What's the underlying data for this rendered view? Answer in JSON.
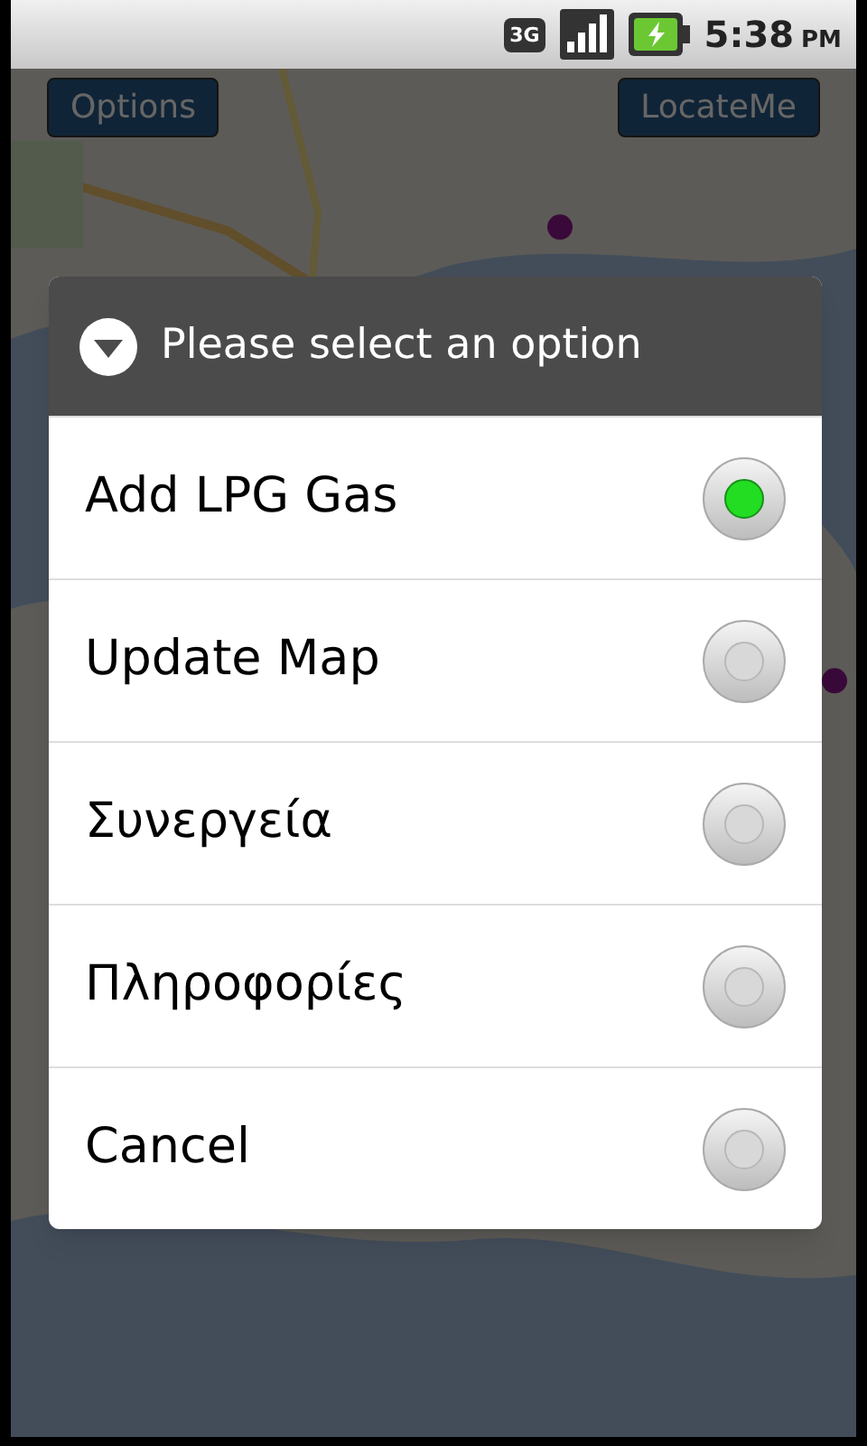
{
  "status_bar": {
    "network_type": "3G",
    "time": "5:38",
    "meridiem": "PM"
  },
  "toolbar": {
    "buttons": [
      "Options",
      "LocateMe"
    ]
  },
  "dialog": {
    "title": "Please select an option",
    "options": [
      {
        "label": "Add LPG Gas",
        "selected": true
      },
      {
        "label": "Update Map",
        "selected": false
      },
      {
        "label": "Συνεργεία",
        "selected": false
      },
      {
        "label": "Πληροφορίες",
        "selected": false
      },
      {
        "label": "Cancel",
        "selected": false
      }
    ]
  }
}
